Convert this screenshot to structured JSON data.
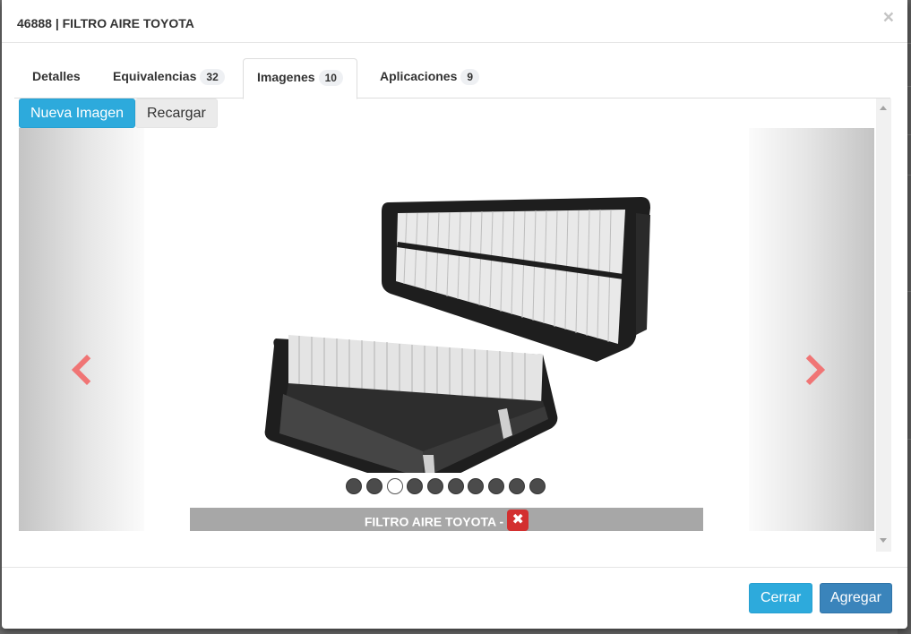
{
  "modal": {
    "title": "46888 | FILTRO AIRE TOYOTA",
    "close_glyph": "×"
  },
  "tabs": [
    {
      "label": "Detalles",
      "badge": null,
      "active": false
    },
    {
      "label": "Equivalencias",
      "badge": "32",
      "active": false
    },
    {
      "label": "Imagenes",
      "badge": "10",
      "active": true
    },
    {
      "label": "Aplicaciones",
      "badge": "9",
      "active": false
    }
  ],
  "toolbar": {
    "new_image_label": "Nueva Imagen",
    "reload_label": "Recargar"
  },
  "carousel": {
    "image_icon": "air-filter-product-image",
    "prev_icon": "chevron-left-icon",
    "next_icon": "chevron-right-icon",
    "total_images": 10,
    "active_index": 2,
    "caption": "FILTRO AIRE TOYOTA -",
    "delete_glyph": "✖",
    "arrow_color": "#f07575"
  },
  "footer": {
    "close_label": "Cerrar",
    "add_label": "Agregar"
  },
  "colors": {
    "primary_info": "#2daadc",
    "primary": "#3a84bb",
    "danger": "#d32f2f"
  }
}
